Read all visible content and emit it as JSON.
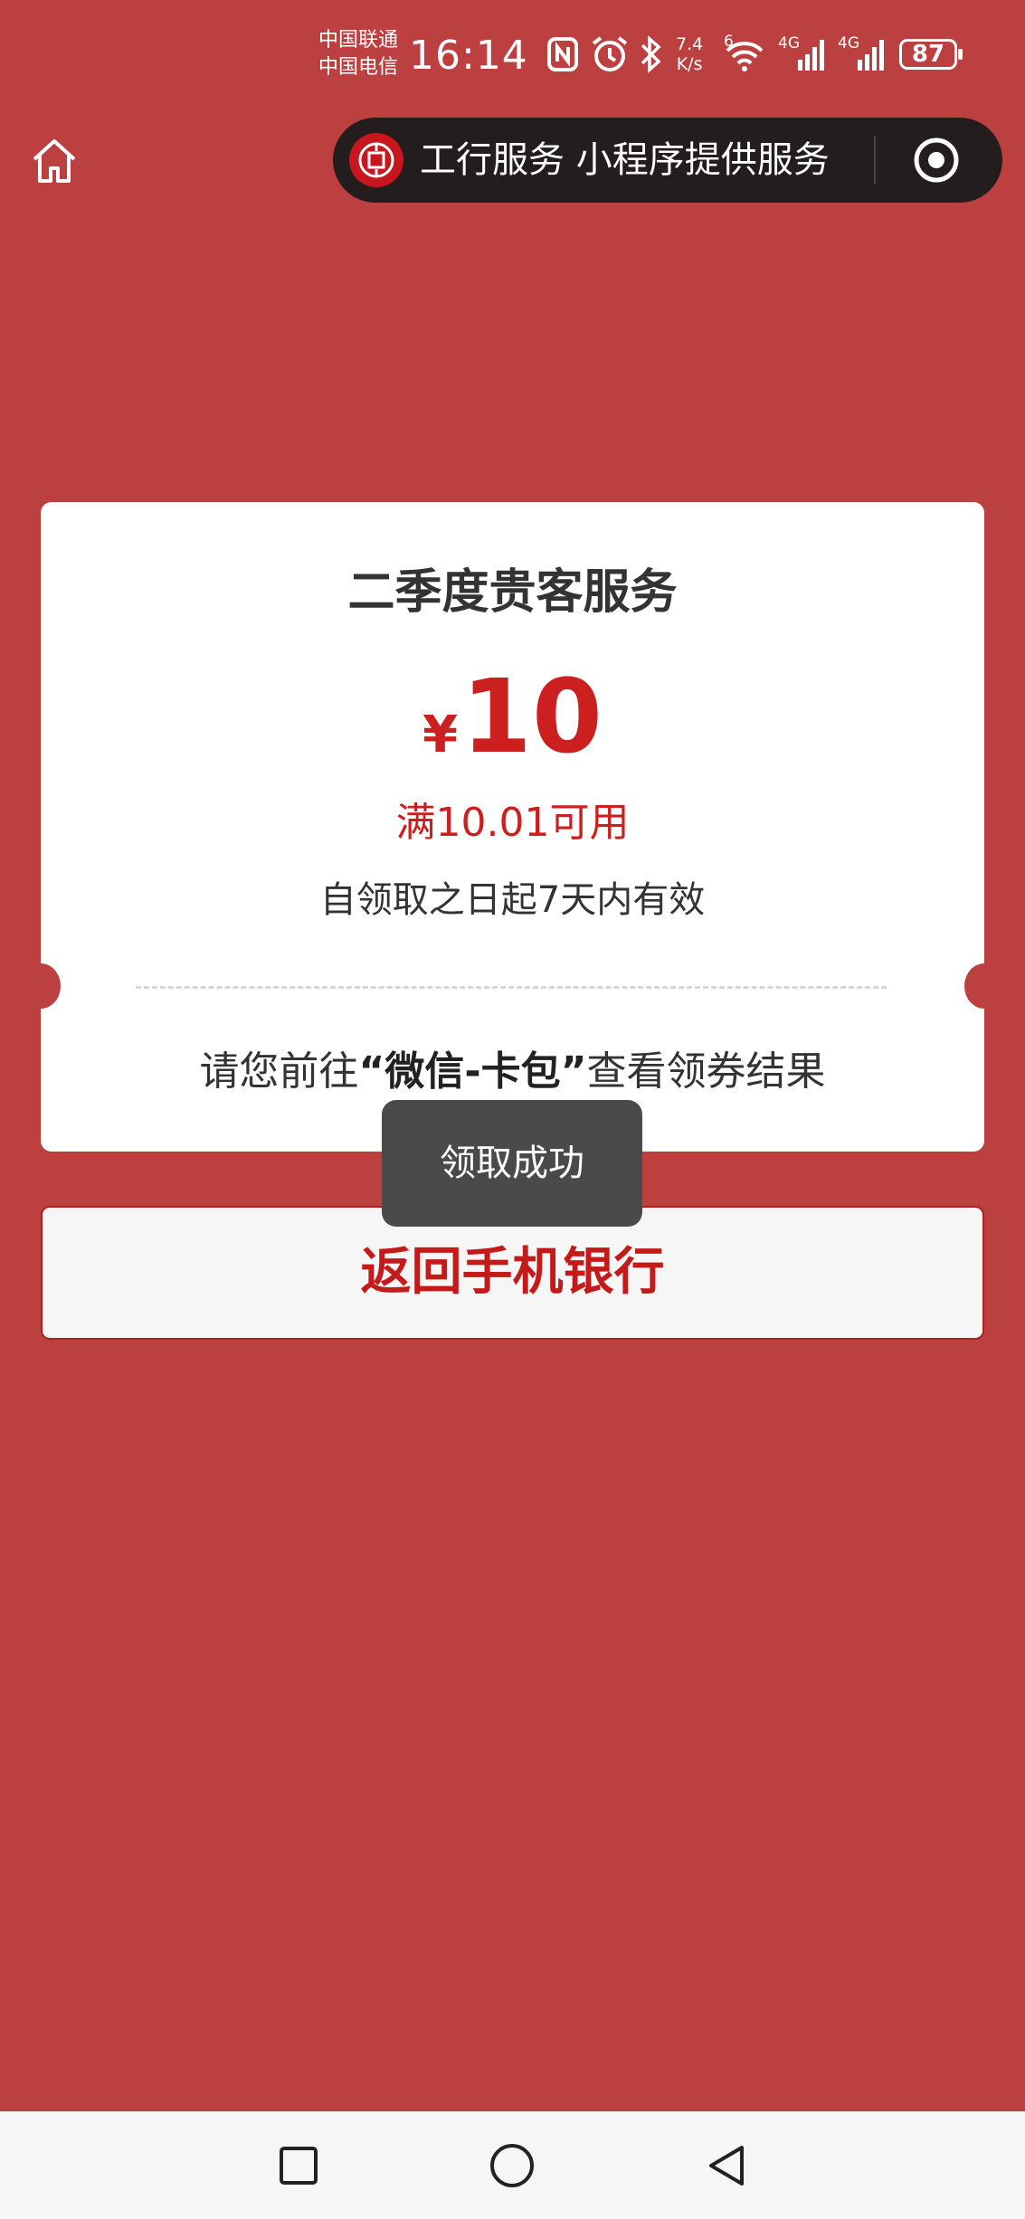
{
  "status_bar": {
    "carrier_1": "中国联通",
    "carrier_2": "中国电信",
    "time": "16:14",
    "net_speed_value": "7.4",
    "net_speed_unit": "K/s",
    "wifi_badge": "6",
    "signal_1_label": "4G",
    "signal_2_label": "4G",
    "battery": "87",
    "icons": [
      "nfc-icon",
      "alarm-icon",
      "bluetooth-icon",
      "wifi-icon",
      "signal-icon",
      "signal-icon",
      "battery-icon"
    ]
  },
  "nav": {
    "home_icon": "home-icon",
    "capsule_title": "工行服务 小程序提供服务",
    "capsule_close_icon": "target-close-icon"
  },
  "coupon": {
    "title": "二季度贵客服务",
    "currency": "¥",
    "amount": "10",
    "condition": "满10.01可用",
    "validity": "自领取之日起7天内有效",
    "hint_prefix": "请您前往",
    "hint_emphasis": "“微信-卡包”",
    "hint_suffix": "查看领券结果"
  },
  "return_button": "返回手机银行",
  "toast": "领取成功",
  "system_nav": {
    "recent_icon": "square-recent-icon",
    "home_icon": "circle-home-icon",
    "back_icon": "triangle-back-icon"
  },
  "colors": {
    "background": "#bd4040",
    "accent_red": "#cc1f1f",
    "capsule": "#231d1d",
    "toast": "#4a4a4a"
  }
}
